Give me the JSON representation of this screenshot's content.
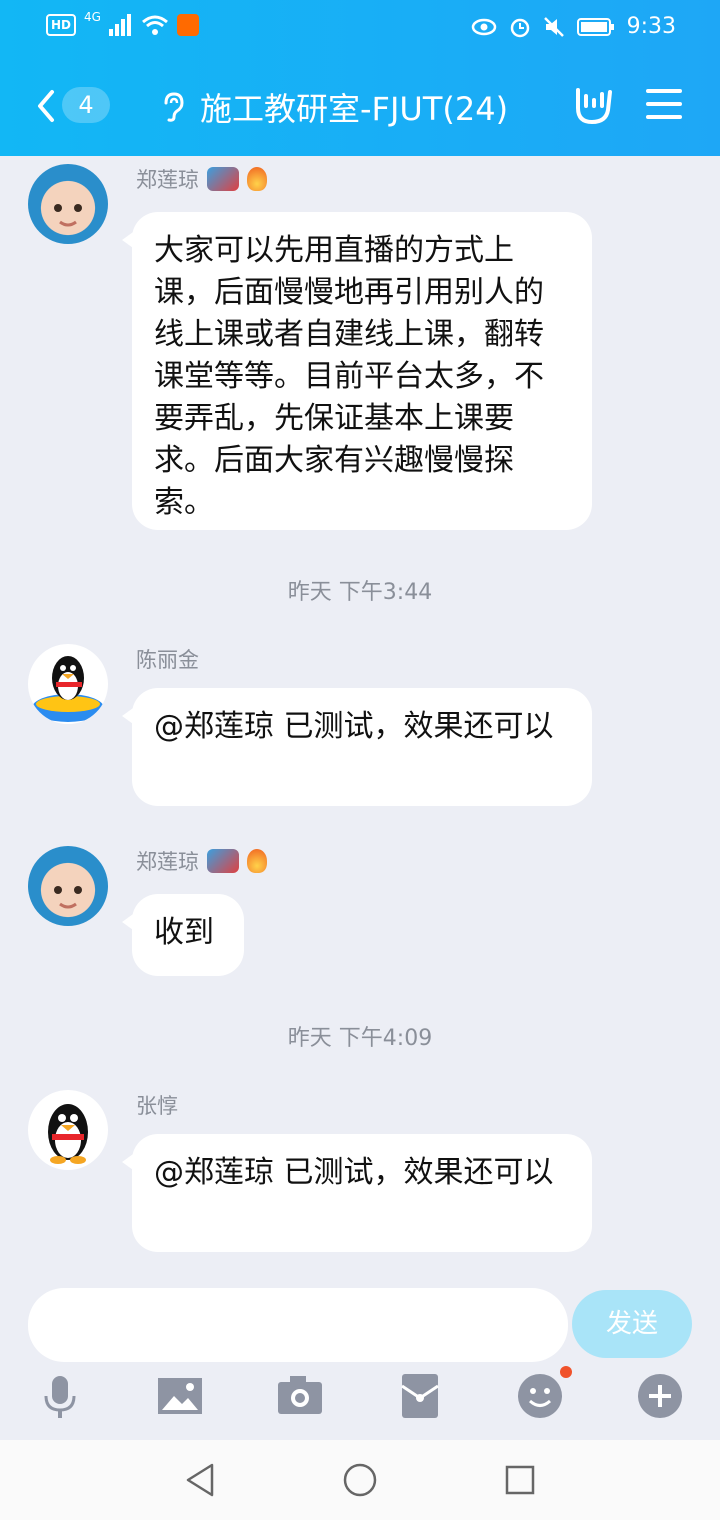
{
  "status_bar": {
    "network": "4G",
    "hd": "HD",
    "time": "9:33"
  },
  "header": {
    "unread_count": "4",
    "title": "施工教研室-FJUT(24)"
  },
  "messages": [
    {
      "sender": "郑莲琼",
      "text": "大家可以先用直播的方式上课，后面慢慢地再引用别人的线上课或者自建线上课，翻转课堂等等。目前平台太多，不要弄乱，先保证基本上课要求。后面大家有兴趣慢慢探索。"
    },
    {
      "sender": "陈丽金",
      "text": "@郑莲琼 已测试，效果还可以"
    },
    {
      "sender": "郑莲琼",
      "text": "收到"
    },
    {
      "sender": "张惇",
      "text": "@郑莲琼 已测试，效果还可以"
    }
  ],
  "timestamps": [
    "昨天 下午3:44",
    "昨天 下午4:09"
  ],
  "composer": {
    "placeholder": "",
    "send_label": "发送"
  },
  "toolbar": {
    "icons": [
      "mic-icon",
      "image-icon",
      "camera-icon",
      "red-packet-icon",
      "emoji-icon",
      "plus-icon"
    ]
  },
  "colors": {
    "accent": "#12b7f5",
    "send_disabled": "#a9e4f8",
    "notify_dot": "#f0522b"
  }
}
